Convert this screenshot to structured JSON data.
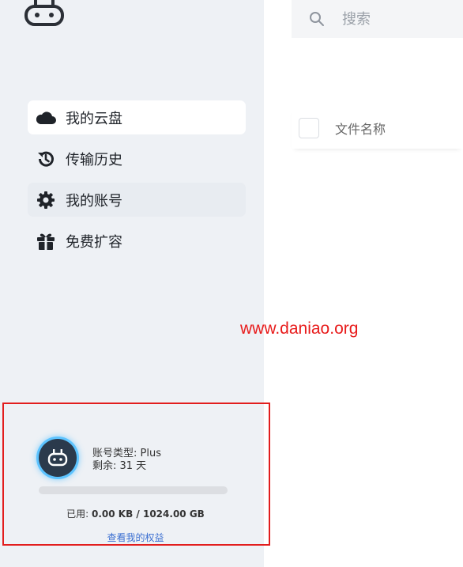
{
  "sidebar": {
    "logo_icon": "robot-logo-icon",
    "items": [
      {
        "icon": "cloud-icon",
        "label": "我的云盘",
        "state": "active"
      },
      {
        "icon": "history-icon",
        "label": "传输历史",
        "state": "normal"
      },
      {
        "icon": "gear-icon",
        "label": "我的账号",
        "state": "hover"
      },
      {
        "icon": "gift-icon",
        "label": "免费扩容",
        "state": "normal"
      }
    ]
  },
  "account": {
    "type_label": "账号类型: Plus",
    "remaining_label": "剩余: 31 天",
    "usage_prefix": "已用: ",
    "usage_value": "0.00 KB / 1024.00 GB",
    "usage_fraction": 0,
    "rights_link": "查看我的权益"
  },
  "search": {
    "placeholder": "搜索"
  },
  "file_list": {
    "column_name": "文件名称"
  },
  "watermark": "www.daniao.org",
  "colors": {
    "accent": "#4a90e2",
    "sidebar_bg": "#eef1f5",
    "highlight_border": "#e21d1d",
    "watermark": "#e81b1b"
  }
}
